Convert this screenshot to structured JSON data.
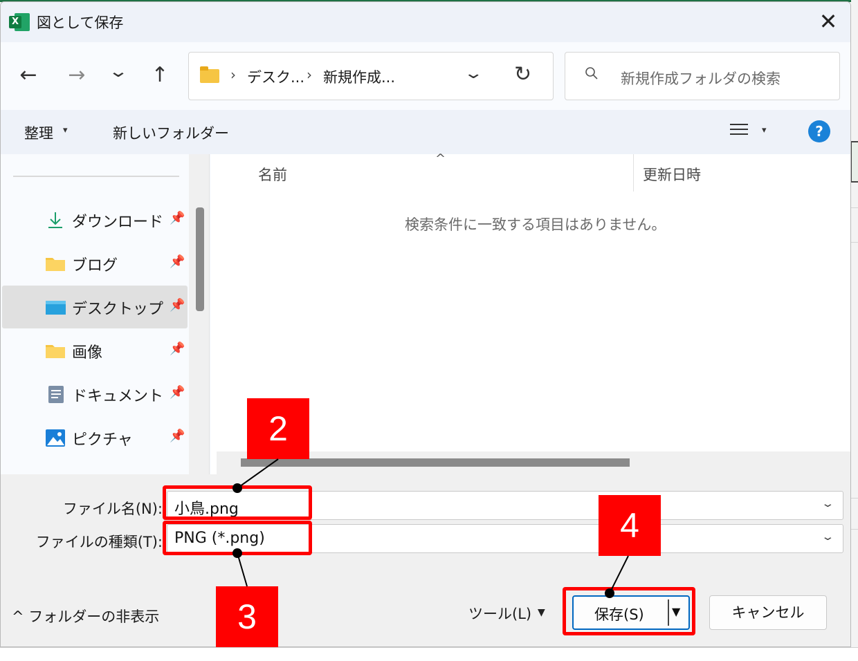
{
  "dialog": {
    "title": "図として保存",
    "close_symbol": "✕",
    "app_icon_letter": "X"
  },
  "nav": {
    "back_symbol": "←",
    "forward_symbol": "→",
    "recent_symbol": "⌄",
    "up_symbol": "↑",
    "breadcrumb": [
      "デスク...",
      "新規作成..."
    ],
    "breadcrumb_sep": "›",
    "address_chevron": "⌄",
    "refresh_symbol": "↻",
    "search_placeholder": "新規作成フォルダの検索"
  },
  "toolbar": {
    "organize": "整理",
    "new_folder": "新しいフォルダー",
    "caret": "▾",
    "help": "?"
  },
  "sidebar": {
    "items": [
      {
        "label": "ダウンロード",
        "icon": "download-icon"
      },
      {
        "label": "ブログ",
        "icon": "folder-icon"
      },
      {
        "label": "デスクトップ",
        "icon": "desktop-icon",
        "selected": true
      },
      {
        "label": "画像",
        "icon": "folder-icon"
      },
      {
        "label": "ドキュメント",
        "icon": "document-icon"
      },
      {
        "label": "ピクチャ",
        "icon": "pictures-icon"
      }
    ],
    "pin_symbol": "📌"
  },
  "content": {
    "col_name": "名前",
    "col_date": "更新日時",
    "sort_symbol": "^",
    "empty_message": "検索条件に一致する項目はありません。"
  },
  "form": {
    "filename_label": "ファイル名(N):",
    "filename_value": "小鳥.png",
    "filetype_label": "ファイルの種類(T):",
    "filetype_value": "PNG (*.png)",
    "chevron": "⌄"
  },
  "footer": {
    "hide_folders": "^ フォルダーの非表示",
    "tools": "ツール(L)",
    "tools_caret": "▼",
    "save": "保存(S)",
    "save_caret": "▼",
    "cancel": "キャンセル"
  },
  "annotations": {
    "step2": "2",
    "step3": "3",
    "step4": "4",
    "color": "#ff0000"
  }
}
